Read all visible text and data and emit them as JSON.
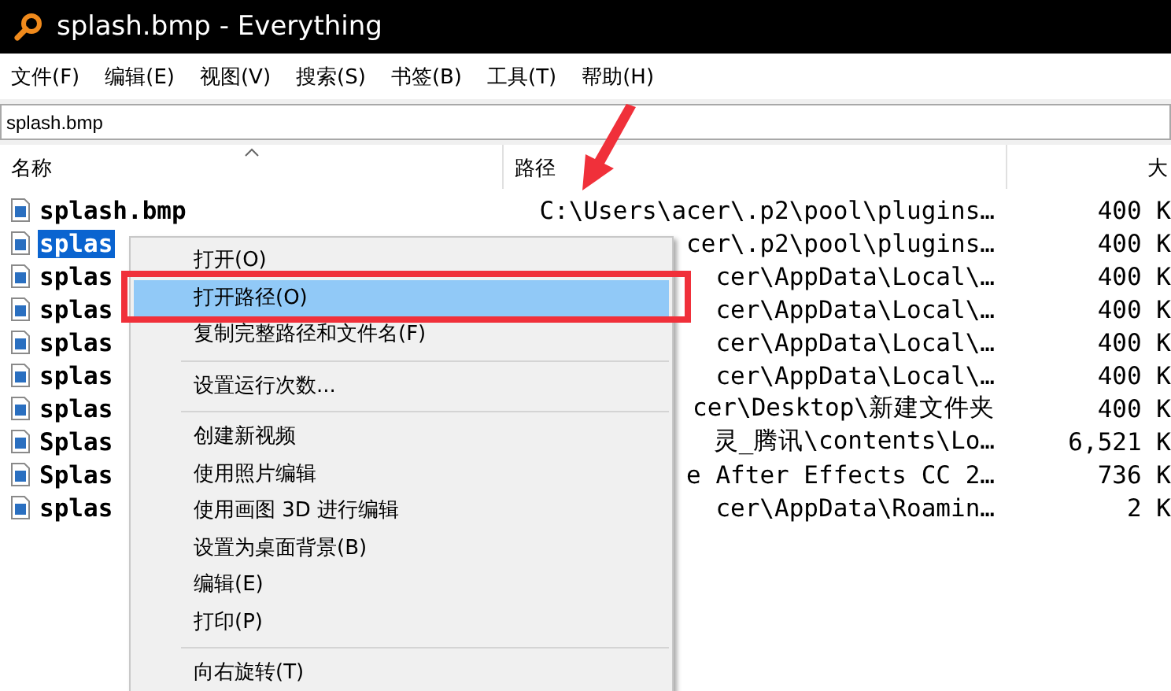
{
  "window": {
    "title": "splash.bmp - Everything"
  },
  "menu_bar": [
    "文件(F)",
    "编辑(E)",
    "视图(V)",
    "搜索(S)",
    "书签(B)",
    "工具(T)",
    "帮助(H)"
  ],
  "search": {
    "value": "splash.bmp"
  },
  "table": {
    "columns": [
      {
        "label": "名称",
        "sorted": true
      },
      {
        "label": "路径",
        "sorted": false
      },
      {
        "label": "大",
        "sorted": false
      }
    ],
    "rows": [
      {
        "name": "splash.bmp",
        "path": "C:\\Users\\acer\\.p2\\pool\\plugins…",
        "size": "400 K",
        "selected": false
      },
      {
        "name": "splas",
        "path": "cer\\.p2\\pool\\plugins…",
        "size": "400 K",
        "selected": true
      },
      {
        "name": "splas",
        "path": "cer\\AppData\\Local\\…",
        "size": "400 K",
        "selected": false
      },
      {
        "name": "splas",
        "path": "cer\\AppData\\Local\\…",
        "size": "400 K",
        "selected": false
      },
      {
        "name": "splas",
        "path": "cer\\AppData\\Local\\…",
        "size": "400 K",
        "selected": false
      },
      {
        "name": "splas",
        "path": "cer\\AppData\\Local\\…",
        "size": "400 K",
        "selected": false
      },
      {
        "name": "splas",
        "path": "cer\\Desktop\\新建文件夹",
        "size": "400 K",
        "selected": false
      },
      {
        "name": "Splas",
        "path": "灵_腾讯\\contents\\Lo…",
        "size": "6,521 K",
        "selected": false
      },
      {
        "name": "Splas",
        "path": "e After Effects CC 2…",
        "size": "736 K",
        "selected": false
      },
      {
        "name": "splas",
        "path": "cer\\AppData\\Roamin…",
        "size": "2 K",
        "selected": false
      }
    ]
  },
  "context_menu": [
    {
      "kind": "item",
      "label": "打开(O)",
      "selected": false
    },
    {
      "kind": "item",
      "label": "打开路径(O)",
      "selected": true
    },
    {
      "kind": "item",
      "label": "复制完整路径和文件名(F)",
      "selected": false
    },
    {
      "kind": "separator"
    },
    {
      "kind": "item",
      "label": "设置运行次数...",
      "selected": false
    },
    {
      "kind": "separator"
    },
    {
      "kind": "item",
      "label": "创建新视频",
      "selected": false
    },
    {
      "kind": "item",
      "label": "使用照片编辑",
      "selected": false
    },
    {
      "kind": "item",
      "label": "使用画图 3D 进行编辑",
      "selected": false
    },
    {
      "kind": "item",
      "label": "设置为桌面背景(B)",
      "selected": false
    },
    {
      "kind": "item",
      "label": "编辑(E)",
      "selected": false
    },
    {
      "kind": "item",
      "label": "打印(P)",
      "selected": false
    },
    {
      "kind": "separator"
    },
    {
      "kind": "item",
      "label": "向右旋转(T)",
      "selected": false
    }
  ]
}
